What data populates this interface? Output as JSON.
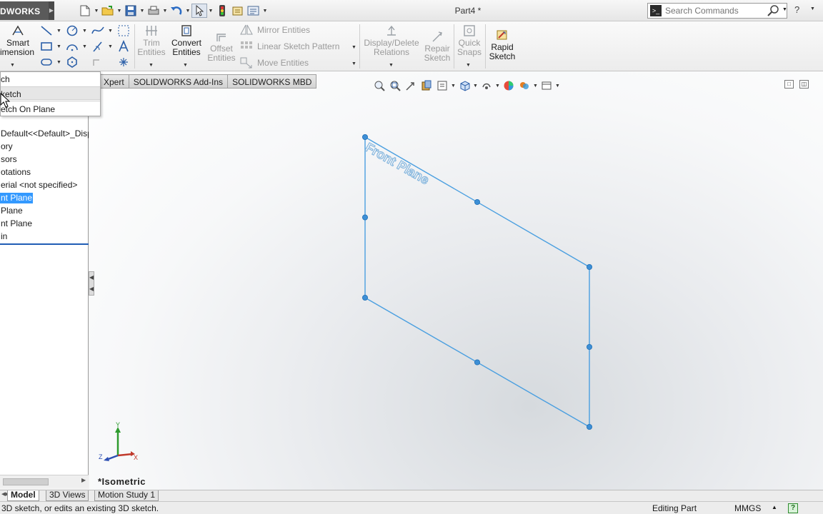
{
  "app": {
    "logo_text": "DWORKS",
    "document_title": "Part4 *"
  },
  "search": {
    "placeholder": "Search Commands"
  },
  "ribbon": {
    "smart_dimension": [
      "Smart",
      "imension"
    ],
    "trim_entities": [
      "Trim",
      "Entities"
    ],
    "convert_entities": [
      "Convert",
      "Entities"
    ],
    "offset_entities": [
      "Offset",
      "Entities"
    ],
    "mirror_entities": "Mirror Entities",
    "linear_sketch_pattern": "Linear Sketch Pattern",
    "move_entities": "Move Entities",
    "display_delete_relations": [
      "Display/Delete",
      "Relations"
    ],
    "repair_sketch": [
      "Repair",
      "Sketch"
    ],
    "quick_snaps": [
      "Quick",
      "Snaps"
    ],
    "rapid_sketch": [
      "Rapid",
      "Sketch"
    ]
  },
  "sketch_menu": {
    "items": [
      "ch",
      "ketch",
      "etch On Plane"
    ]
  },
  "command_tabs": [
    "Xpert",
    "SOLIDWORKS Add-Ins",
    "SOLIDWORKS MBD"
  ],
  "feature_tree": {
    "items": [
      "Default<<Default>_Disp",
      "ory",
      "sors",
      "otations",
      "erial <not specified>",
      "nt Plane",
      " Plane",
      "nt Plane",
      "in"
    ],
    "selected_index": 5
  },
  "graphics": {
    "plane_label": "Front Plane",
    "view_label": "*Isometric",
    "triad_axes": [
      "Y",
      "X",
      "Z"
    ],
    "colors": {
      "sketch_line": "#4a9fe0",
      "sketch_point": "#3d8fd6",
      "plane_label": "#7fb3dd"
    }
  },
  "bottom_tabs": [
    "Model",
    "3D Views",
    "Motion Study 1"
  ],
  "status": {
    "message": "3D sketch, or edits an existing 3D sketch.",
    "mode": "Editing Part",
    "units": "MMGS",
    "help": "?"
  }
}
